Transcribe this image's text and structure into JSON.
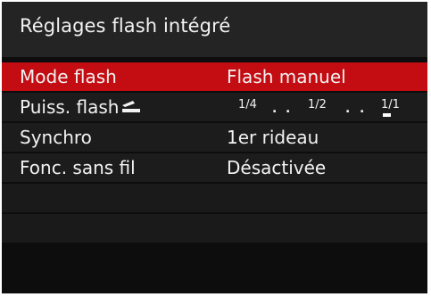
{
  "screen": {
    "title": "Réglages flash intégré"
  },
  "menu": {
    "items": [
      {
        "label": "Mode flash",
        "value": "Flash manuel",
        "selected": true
      },
      {
        "label": "Puiss. flash",
        "icon": "flash-power-icon",
        "scale": [
          "1/4",
          ".",
          ".",
          "1/2",
          ".",
          ".",
          "1/1"
        ],
        "current": "1/1"
      },
      {
        "label": "Synchro",
        "value": "1er rideau"
      },
      {
        "label": "Fonc. sans fil",
        "value": "Désactivée"
      }
    ]
  },
  "colors": {
    "background": "#0d0d0d",
    "row": "#1c1c1c",
    "title_bar": "#242424",
    "selection": "#c30d12",
    "text": "#f2f2f2"
  }
}
